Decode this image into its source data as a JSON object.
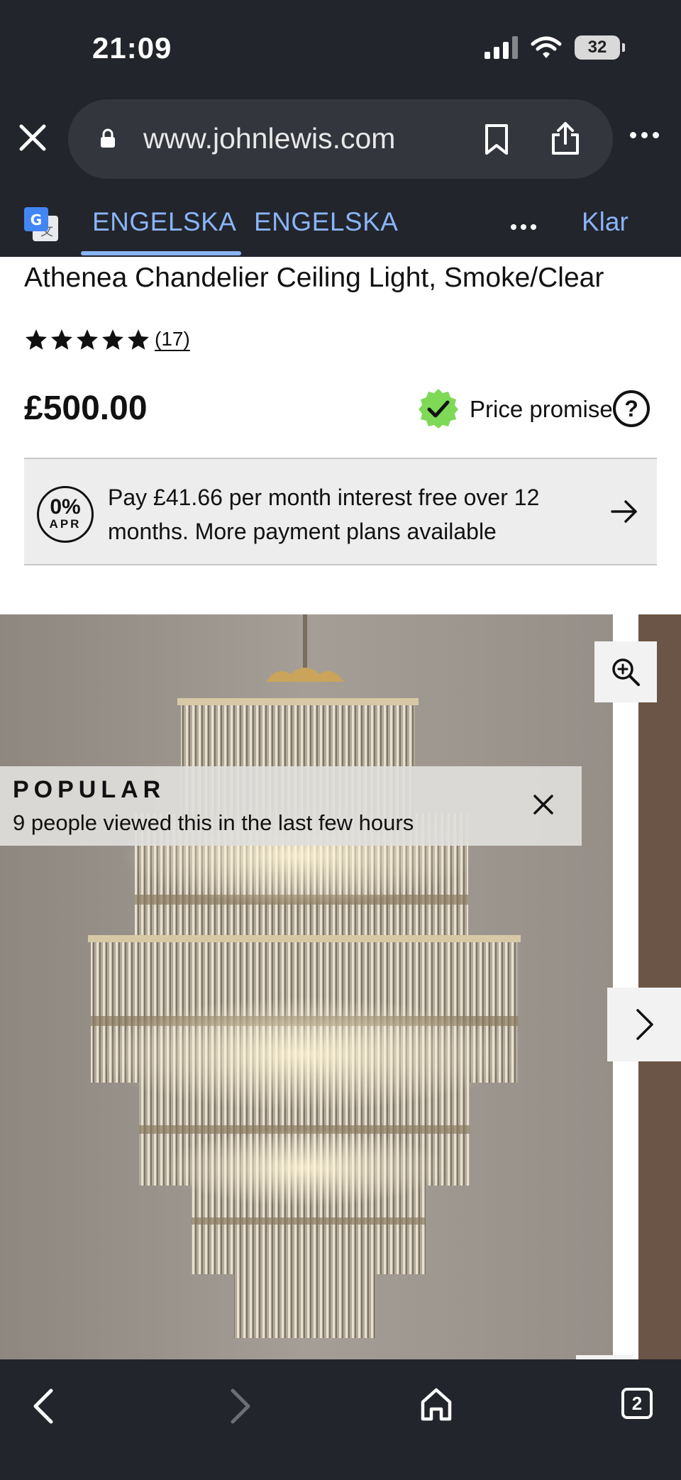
{
  "status_bar": {
    "time": "21:09",
    "battery": "32"
  },
  "browser": {
    "url": "www.johnlewis.com",
    "translate": {
      "tabs": [
        "ENGELSKA",
        "ENGELSKA"
      ],
      "done_label": "Klar"
    }
  },
  "product": {
    "title": "Athenea Chandelier Ceiling Light, Smoke/Clear",
    "rating": 5,
    "review_count": "(17)",
    "price": "£500.00",
    "price_promise_label": "Price promise",
    "help_label": "?",
    "apr": {
      "badge_percent": "0%",
      "badge_label": "APR",
      "text": "Pay £41.66 per month interest free over 12 months. More payment plans available"
    }
  },
  "gallery": {
    "popular_title": "POPULAR",
    "popular_text": "9 people viewed this in the last few hours"
  },
  "toolbar": {
    "tab_count": "2"
  },
  "colors": {
    "chrome_bg": "#22252b",
    "link_blue": "#8ab4f8",
    "promise_green": "#7ed957",
    "apr_box_bg": "#ededed"
  }
}
